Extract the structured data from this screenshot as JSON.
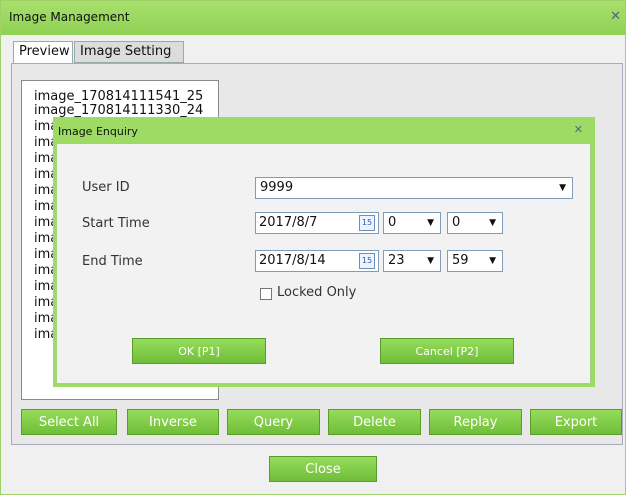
{
  "window": {
    "title": "Image Management",
    "close_glyph": "✕"
  },
  "tabs": [
    {
      "label": "Preview"
    },
    {
      "label": "Image Setting"
    }
  ],
  "image_list": [
    "image_170814111541_25",
    "image_170814111330_24",
    "ima",
    "ima",
    "ima",
    "ima",
    "ima",
    "ima",
    "ima",
    "ima",
    "ima",
    "ima",
    "ima",
    "ima",
    "ima",
    "ima"
  ],
  "toolbar": {
    "select_all": "Select All",
    "inverse": "Inverse",
    "query": "Query",
    "delete": "Delete",
    "replay": "Replay",
    "export": "Export"
  },
  "footer": {
    "close": "Close"
  },
  "dialog": {
    "title": "Image Enquiry",
    "close_glyph": "✕",
    "user_id_label": "User ID",
    "user_id_value": "9999",
    "start_time_label": "Start Time",
    "start_date": "2017/8/7",
    "start_hour": "0",
    "start_minute": "0",
    "end_time_label": "End Time",
    "end_date": "2017/8/14",
    "end_hour": "23",
    "end_minute": "59",
    "locked_only_label": "Locked Only",
    "locked_only_checked": false,
    "calendar_glyph": "15",
    "dropdown_glyph": "▼",
    "ok_label": "OK [P1]",
    "cancel_label": "Cancel [P2]"
  }
}
